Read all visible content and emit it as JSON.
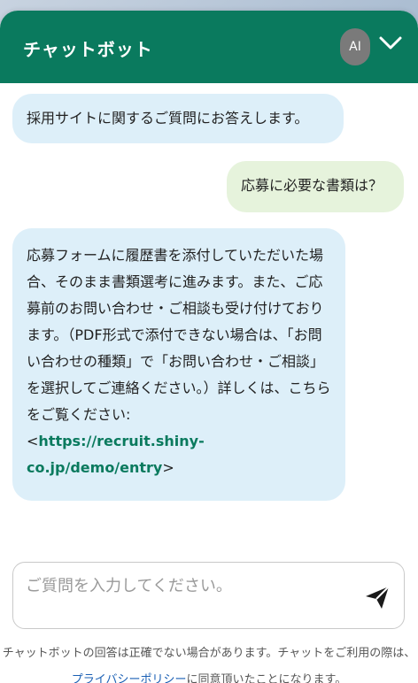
{
  "header": {
    "title": "チャットボット",
    "ai_badge": "AI",
    "collapse_icon": "chevron-down-icon"
  },
  "messages": {
    "bot_1": "採用サイトに関するご質問にお答えします。",
    "user_1": "応募に必要な書類は？",
    "bot_2_text": "応募フォームに履歴書を添付していただいた場合、そのまま書類選考に進みます。また、ご応募前のお問い合わせ・ご相談も受け付けております。（PDF形式で添付できない場合は、「お問い合わせの種類」で「お問い合わせ・ご相談」を選択してご連絡ください。）詳しくは、こちらをご覧ください:",
    "bot_2_lt": "<",
    "bot_2_link": "https://recruit.shiny-co.jp/demo/entry",
    "bot_2_gt": ">"
  },
  "input": {
    "placeholder": "ご質問を入力してください。",
    "value": "",
    "send_icon": "send-icon"
  },
  "footer": {
    "disclaimer_1": "チャットボットの回答は正確でない場合があります。チャットをご利用の際は、",
    "privacy_link": "プライバシーポリシー",
    "disclaimer_2": "に同意頂いたことになります。"
  },
  "colors": {
    "header_bg": "#0a7a5e",
    "bot_bubble": "#ddeff9",
    "user_bubble": "#e6f3dc",
    "link_green": "#0a7a5e",
    "link_blue": "#1a5fb4"
  }
}
